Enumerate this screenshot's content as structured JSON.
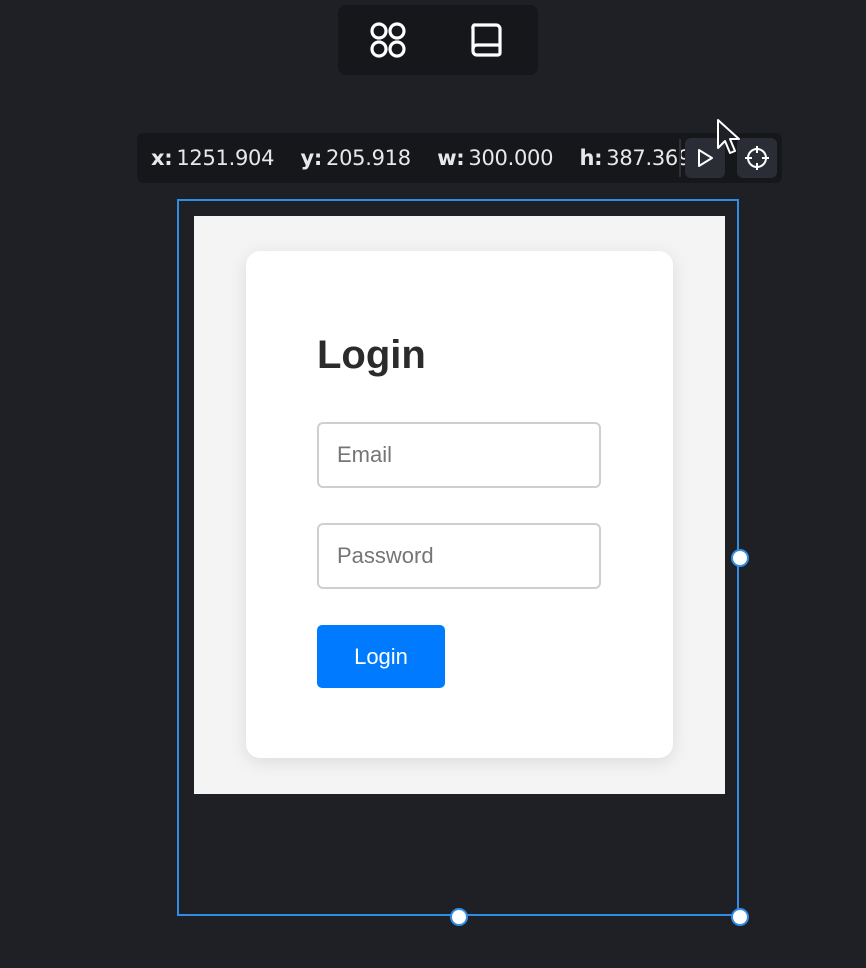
{
  "toolbar": {
    "icons": [
      "components-icon",
      "book-icon"
    ]
  },
  "coordinates": {
    "x_label": "x:",
    "x_value": "1251.904",
    "y_label": "y:",
    "y_value": "205.918",
    "w_label": "w:",
    "w_value": "300.000",
    "h_label": "h:",
    "h_value": "387.369",
    "icons": [
      "play-icon",
      "crosshair-icon"
    ]
  },
  "preview": {
    "title": "Login",
    "email_placeholder": "Email",
    "password_placeholder": "Password",
    "login_button_label": "Login"
  },
  "colors": {
    "background": "#1e2026",
    "selection": "#2f8de4",
    "primary_button": "#007bff"
  }
}
